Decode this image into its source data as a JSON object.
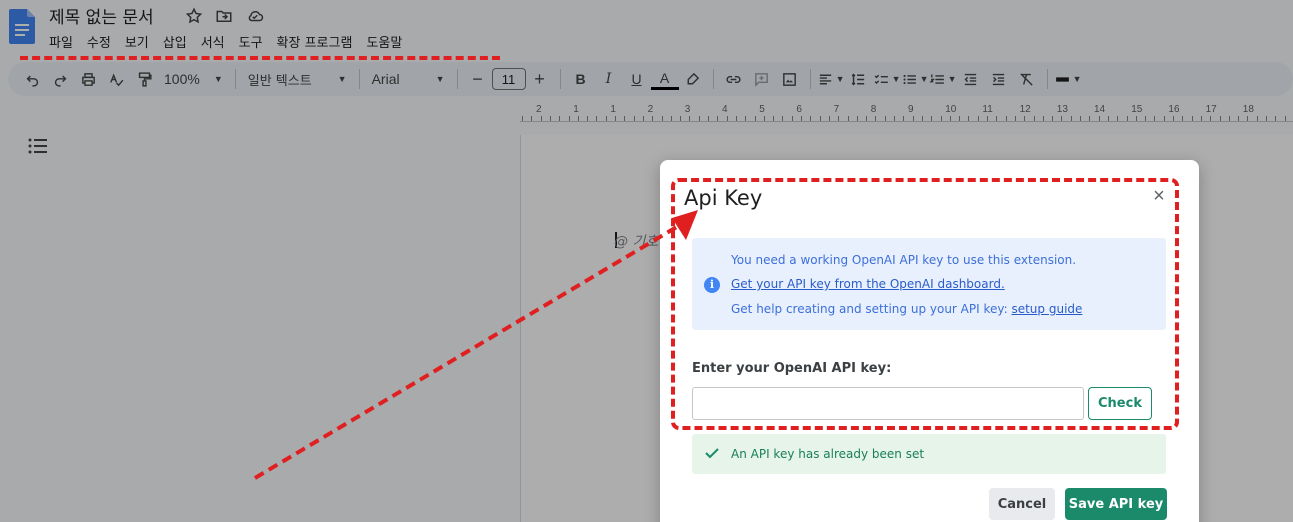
{
  "doc": {
    "title": "제목 없는 문서",
    "menu": [
      "파일",
      "수정",
      "보기",
      "삽입",
      "서식",
      "도구",
      "확장 프로그램",
      "도움말"
    ]
  },
  "toolbar": {
    "zoom": "100%",
    "style": "일반 텍스트",
    "font": "Arial",
    "font_size": "11",
    "minus": "−",
    "plus": "+"
  },
  "ruler": {
    "labels": [
      "2",
      "1",
      "1",
      "2",
      "3",
      "4",
      "5",
      "6",
      "7",
      "8",
      "9",
      "10",
      "11",
      "12",
      "13",
      "14",
      "15",
      "16",
      "17",
      "18"
    ]
  },
  "page": {
    "placeholder": "@ 기호"
  },
  "modal": {
    "title": "Api Key",
    "close": "×",
    "info": {
      "line1": "You need a working OpenAI API key to use this extension.",
      "link1": "Get your API key from the OpenAI dashboard.",
      "line3_prefix": "Get help creating and setting up your API key: ",
      "line3_link": "setup guide"
    },
    "key_label": "Enter your OpenAI API key:",
    "key_value": "",
    "check_label": "Check",
    "success": "An API key has already been set",
    "cancel_label": "Cancel",
    "save_label": "Save API key"
  },
  "colors": {
    "annotation": "#e02020",
    "primary": "#1a8a6a",
    "info_bg": "#e8f0fe",
    "success_bg": "#e6f4ea"
  }
}
